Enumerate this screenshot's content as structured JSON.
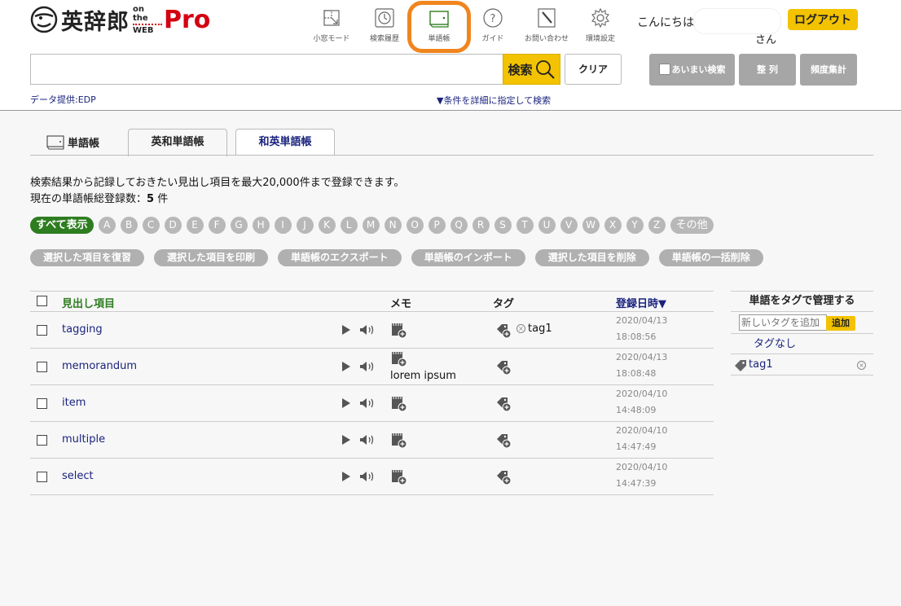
{
  "header": {
    "logo": {
      "main": "英辞郎",
      "sub_line1": "on the",
      "sub_line2": "WEB",
      "pro": "Pro"
    },
    "nav": [
      {
        "label": "小窓モード",
        "icon": "small-window-icon"
      },
      {
        "label": "検索履歴",
        "icon": "clock-icon"
      },
      {
        "label": "単語帳",
        "icon": "wordbook-icon"
      },
      {
        "label": "ガイド",
        "icon": "question-icon"
      },
      {
        "label": "お問い合わせ",
        "icon": "pencil-icon"
      },
      {
        "label": "環境設定",
        "icon": "gear-icon"
      }
    ],
    "greeting": "こんにちは",
    "username": "",
    "san": "さん",
    "logout_label": "ログアウト"
  },
  "search": {
    "value": "",
    "placeholder": "",
    "search_label": "検索",
    "clear_label": "クリア",
    "fuzzy_label": "あいまい検索",
    "sort_label": "整 列",
    "freq_label": "頻度集計",
    "credit": "データ提供:EDP",
    "advanced_link": "▼条件を詳細に指定して検索"
  },
  "tabs": {
    "section_label": "単語帳",
    "items": [
      {
        "label": "英和単語帳",
        "active": true
      },
      {
        "label": "和英単語帳",
        "active": false
      }
    ]
  },
  "info": {
    "line1": "検索結果から記録しておきたい見出し項目を最大20,000件まで登録できます。",
    "line2_prefix": "現在の単語帳総登録数：",
    "count": "5",
    "line2_suffix": " 件"
  },
  "alpha_filter": {
    "all_label": "すべて表示",
    "letters": [
      "A",
      "B",
      "C",
      "D",
      "E",
      "F",
      "G",
      "H",
      "I",
      "J",
      "K",
      "L",
      "M",
      "N",
      "O",
      "P",
      "Q",
      "R",
      "S",
      "T",
      "U",
      "V",
      "W",
      "X",
      "Y",
      "Z"
    ],
    "other_label": "その他"
  },
  "actions": [
    "選択した項目を復習",
    "選択した項目を印刷",
    "単語帳のエクスポート",
    "単語帳のインポート",
    "選択した項目を削除",
    "単語帳の一括削除"
  ],
  "table": {
    "headers": {
      "word": "見出し項目",
      "memo": "メモ",
      "tag": "タグ",
      "date": "登録日時▼"
    },
    "rows": [
      {
        "word": "tagging",
        "memo": "",
        "tag": "tag1",
        "date": "2020/04/13",
        "time": "18:08:56"
      },
      {
        "word": "memorandum",
        "memo": "lorem ipsum",
        "tag": "",
        "date": "2020/04/13",
        "time": "18:08:48"
      },
      {
        "word": "item",
        "memo": "",
        "tag": "",
        "date": "2020/04/10",
        "time": "14:48:09"
      },
      {
        "word": "multiple",
        "memo": "",
        "tag": "",
        "date": "2020/04/10",
        "time": "14:47:49"
      },
      {
        "word": "select",
        "memo": "",
        "tag": "",
        "date": "2020/04/10",
        "time": "14:47:39"
      }
    ]
  },
  "side_panel": {
    "title": "単語をタグで管理する",
    "new_tag_placeholder": "新しいタグを追加",
    "add_label": "追加",
    "no_tag_label": "タグなし",
    "tags": [
      "tag1"
    ]
  },
  "colors": {
    "accent_yellow": "#f3c200",
    "highlight_orange": "#f0851e",
    "link_navy": "#1a237e",
    "green": "#2e7d20",
    "logo_red": "#d30011"
  }
}
